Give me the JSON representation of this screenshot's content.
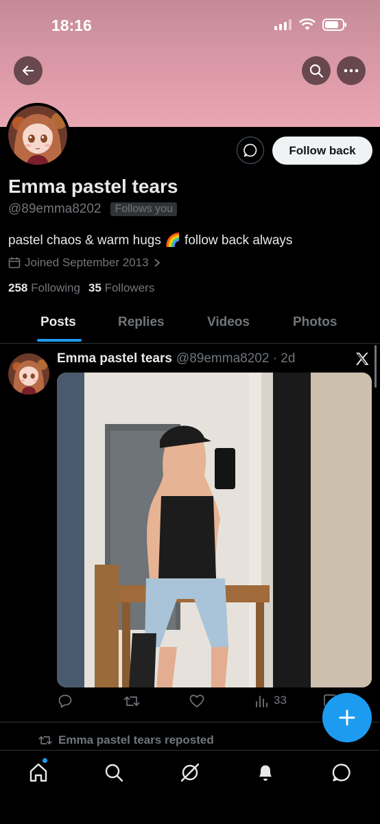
{
  "status_bar": {
    "time": "18:16"
  },
  "profile": {
    "display_name": "Emma pastel tears",
    "handle": "@89emma8202",
    "follows_you": "Follows you",
    "bio": "pastel chaos & warm hugs 🌈 follow back always",
    "joined": "Joined September 2013",
    "following_count": "258",
    "following_label": "Following",
    "followers_count": "35",
    "followers_label": "Followers",
    "follow_button": "Follow back"
  },
  "tabs": [
    {
      "label": "Posts",
      "active": true
    },
    {
      "label": "Replies",
      "active": false
    },
    {
      "label": "Videos",
      "active": false
    },
    {
      "label": "Photos",
      "active": false
    }
  ],
  "post": {
    "author": "Emma pastel tears",
    "handle_time": "@89emma8202 · 2d",
    "views": "33"
  },
  "repost": {
    "text": "Emma pastel tears reposted"
  },
  "icons": {
    "back": "back-arrow-icon",
    "search": "search-icon",
    "more": "more-icon",
    "message": "message-icon",
    "calendar": "calendar-icon",
    "chevron": "chevron-right-icon",
    "reply": "reply-icon",
    "retweet": "retweet-icon",
    "like": "like-icon",
    "views": "views-icon",
    "compose": "compose-plus-icon"
  },
  "colors": {
    "accent": "#1d9bf0",
    "banner": "#dc9aa8",
    "background": "#000000",
    "muted": "#71767b"
  }
}
